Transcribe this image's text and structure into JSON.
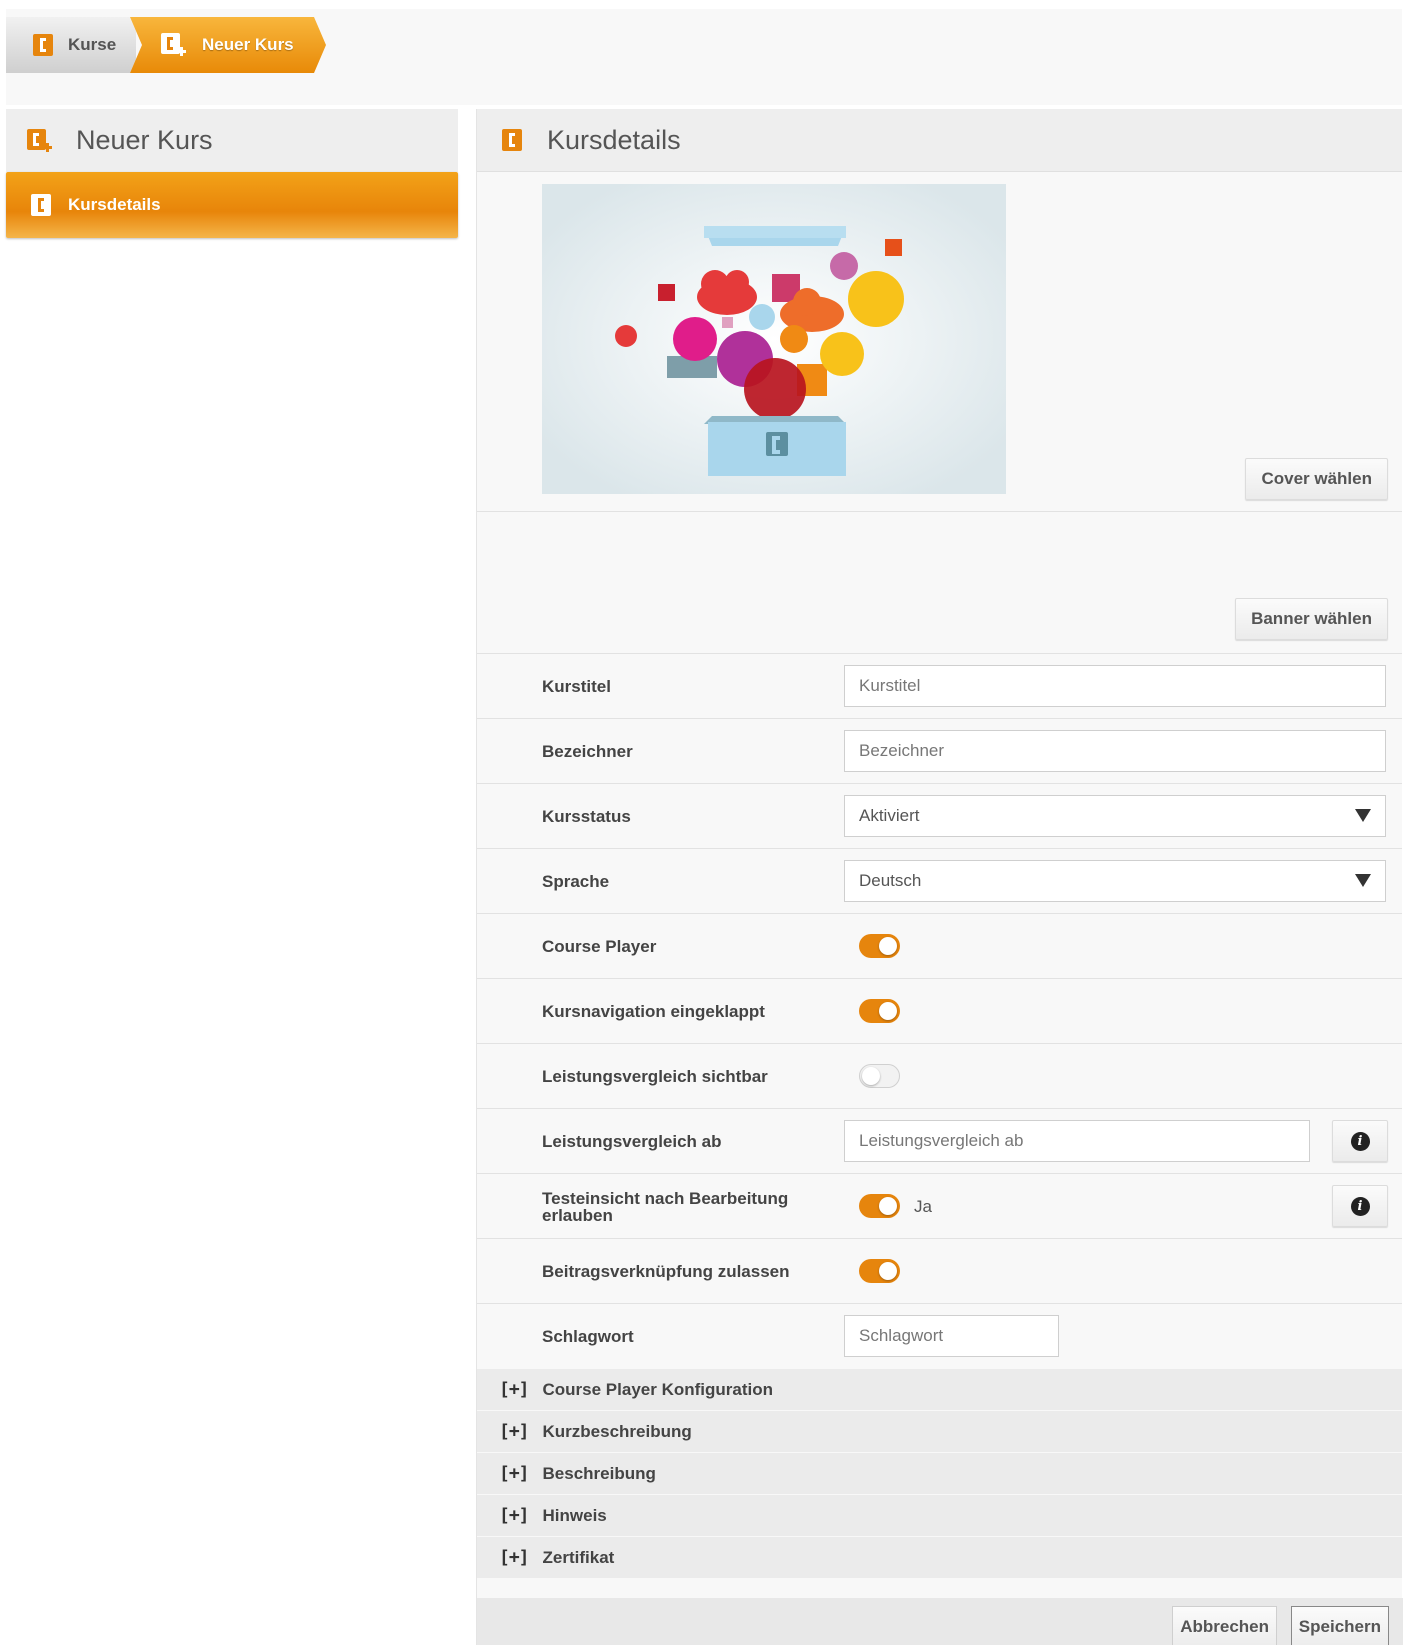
{
  "breadcrumb": {
    "items": [
      {
        "label": "Kurse"
      },
      {
        "label": "Neuer Kurs"
      }
    ]
  },
  "left_panel": {
    "title": "Neuer Kurs",
    "nav_items": [
      {
        "label": "Kursdetails"
      }
    ]
  },
  "main": {
    "title": "Kursdetails",
    "cover_button": "Cover wählen",
    "banner_button": "Banner wählen",
    "fields": {
      "kurstitel": {
        "label": "Kurstitel",
        "placeholder": "Kurstitel"
      },
      "bezeichner": {
        "label": "Bezeichner",
        "placeholder": "Bezeichner"
      },
      "kursstatus": {
        "label": "Kursstatus",
        "value": "Aktiviert"
      },
      "sprache": {
        "label": "Sprache",
        "value": "Deutsch"
      },
      "course_player": {
        "label": "Course Player",
        "enabled": true
      },
      "kursnavigation": {
        "label": "Kursnavigation eingeklappt",
        "enabled": true
      },
      "leistungsvergleich_sichtbar": {
        "label": "Leistungsvergleich sichtbar",
        "enabled": false
      },
      "leistungsvergleich_ab": {
        "label": "Leistungsvergleich ab",
        "placeholder": "Leistungsvergleich ab"
      },
      "testeinsicht": {
        "label": "Testeinsicht nach Bearbeitung erlauben",
        "enabled": true,
        "value_text": "Ja"
      },
      "beitragsverknuepfung": {
        "label": "Beitragsverknüpfung zulassen",
        "enabled": true
      },
      "schlagwort": {
        "label": "Schlagwort",
        "placeholder": "Schlagwort"
      }
    },
    "accordions": [
      {
        "label": "Course Player Konfiguration"
      },
      {
        "label": "Kurzbeschreibung"
      },
      {
        "label": "Beschreibung"
      },
      {
        "label": "Hinweis"
      },
      {
        "label": "Zertifikat"
      }
    ],
    "footer": {
      "cancel_label": "Abbrechen",
      "save_label": "Speichern"
    }
  },
  "colors": {
    "accent": "#e6850d",
    "accent_light": "#f4b54a",
    "panel_bg": "#f8f8f8",
    "header_bg": "#eeeeee"
  },
  "icons": {
    "course": "course-icon",
    "new_course": "new-course-icon",
    "info": "info-icon",
    "expand": "expand-plus-icon",
    "dropdown": "chevron-down-icon"
  }
}
